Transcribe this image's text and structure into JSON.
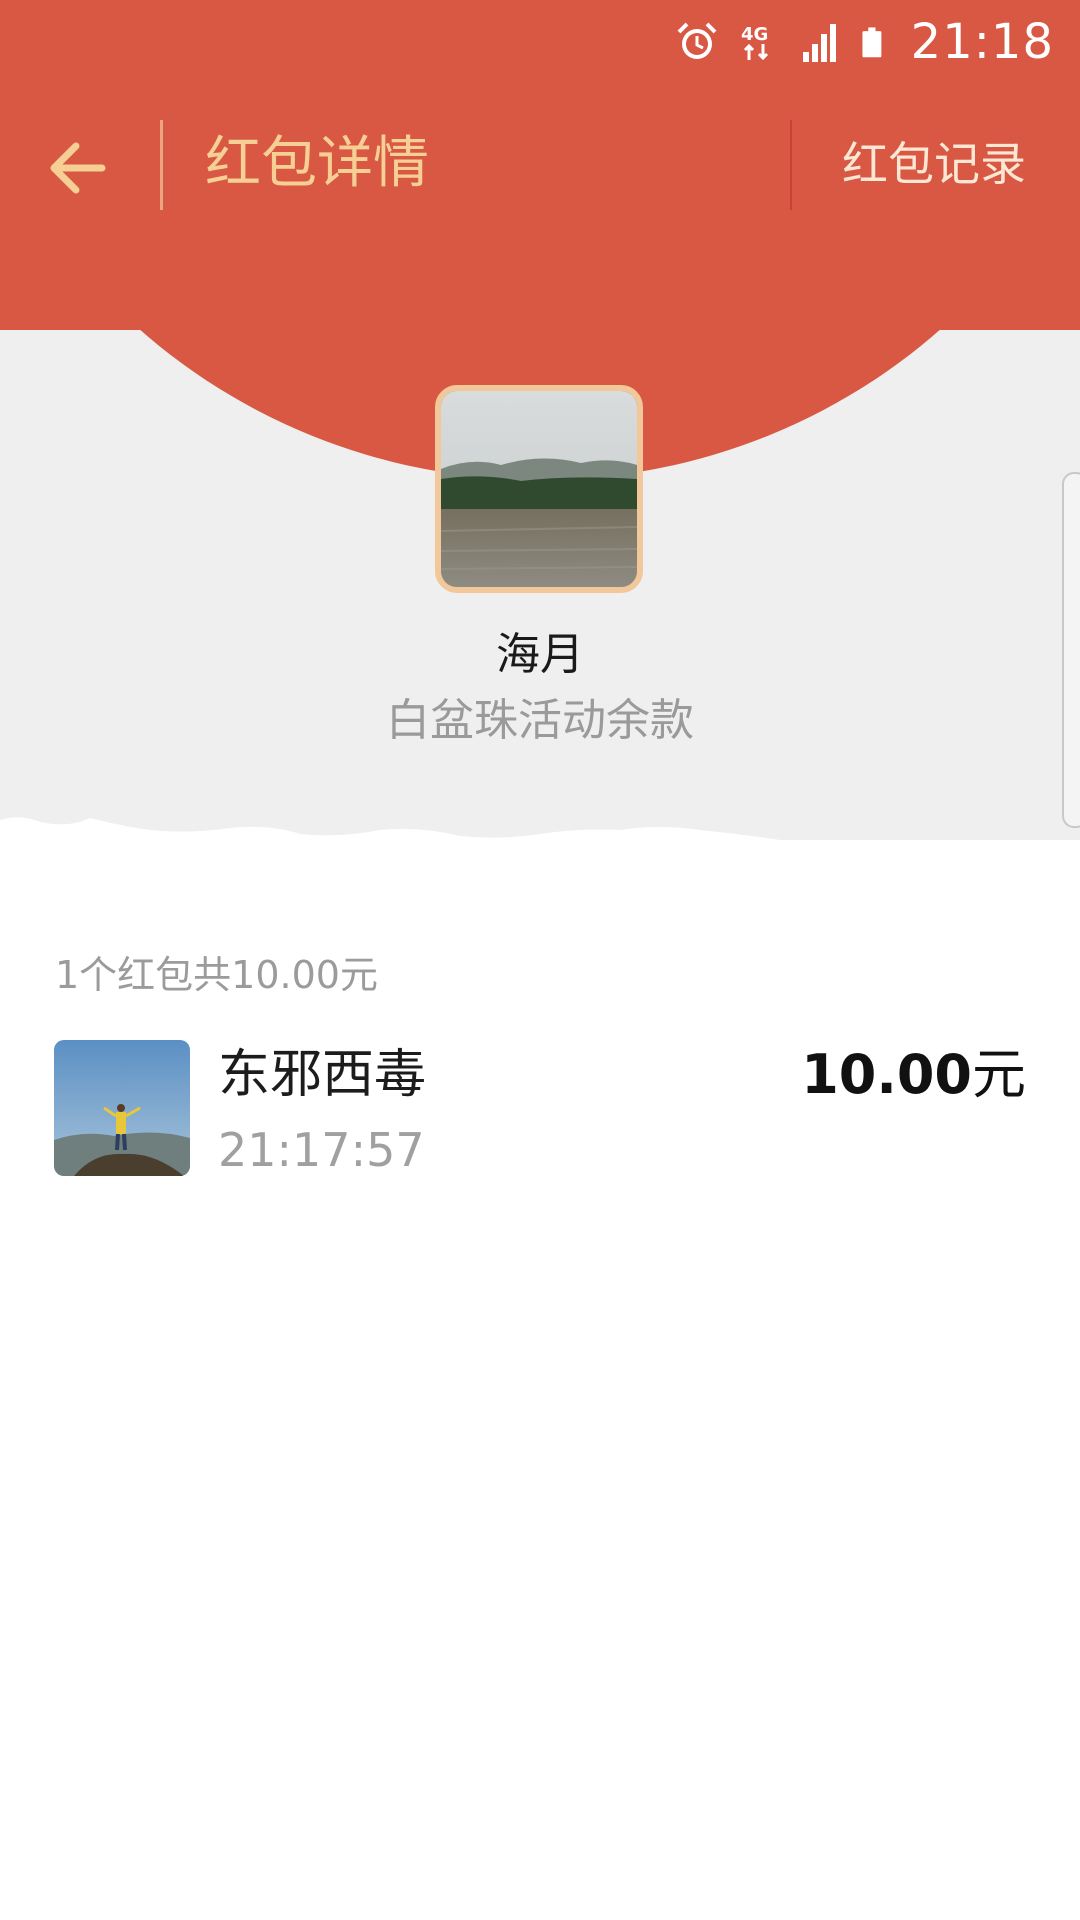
{
  "status_bar": {
    "time": "21:18",
    "network": "4G",
    "icons": [
      "alarm-icon",
      "network-4g-icon",
      "signal-icon",
      "battery-icon"
    ]
  },
  "nav": {
    "title": "红包详情",
    "right_link": "红包记录",
    "back_icon": "back-arrow-icon"
  },
  "sender": {
    "name": "海月",
    "note": "白盆珠活动余款"
  },
  "summary": "1个红包共10.00元",
  "recipients": [
    {
      "name": "东邪西毒",
      "time": "21:17:57",
      "amount": "10.00",
      "unit": "元"
    }
  ],
  "colors": {
    "header_red": "#d85844",
    "title_gold": "#f5cf94",
    "avatar_border": "#f2c79a",
    "background_gray": "#f0efef"
  }
}
